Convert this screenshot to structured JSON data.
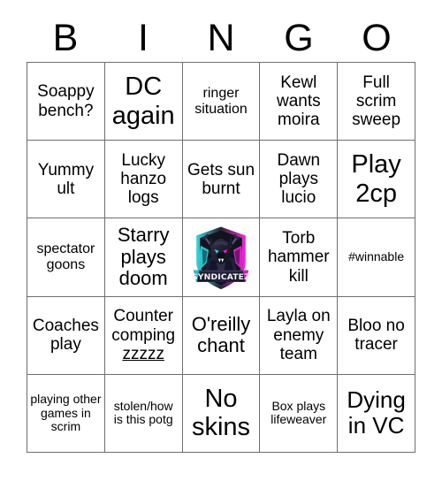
{
  "header": {
    "letters": [
      "B",
      "I",
      "N",
      "G",
      "O"
    ]
  },
  "grid": {
    "rows": [
      [
        {
          "text": "Soappy bench?",
          "size": "fs-m"
        },
        {
          "text": "DC again",
          "size": "fs-xxl"
        },
        {
          "text": "ringer situation",
          "size": "fs-s"
        },
        {
          "text": "Kewl wants moira",
          "size": "fs-m"
        },
        {
          "text": "Full scrim sweep",
          "size": "fs-m"
        }
      ],
      [
        {
          "text": "Yummy ult",
          "size": "fs-m"
        },
        {
          "text": "Lucky hanzo logs",
          "size": "fs-m"
        },
        {
          "text": "Gets sun burnt",
          "size": "fs-m"
        },
        {
          "text": "Dawn plays lucio",
          "size": "fs-m"
        },
        {
          "text": "Play 2cp",
          "size": "fs-xxl"
        }
      ],
      [
        {
          "text": "spectator goons",
          "size": "fs-s"
        },
        {
          "text": "Starry plays doom",
          "size": "fs-l"
        },
        {
          "text": "",
          "size": "fs-m",
          "logo": true
        },
        {
          "text": "Torb hammer kill",
          "size": "fs-m"
        },
        {
          "text": "#winnable",
          "size": "fs-xs"
        }
      ],
      [
        {
          "text": "Coaches play",
          "size": "fs-m"
        },
        {
          "text": "Counter comping zzzzz",
          "size": "fs-m",
          "underline_last_word": true
        },
        {
          "text": "O'reilly chant",
          "size": "fs-l"
        },
        {
          "text": "Layla on enemy team",
          "size": "fs-m"
        },
        {
          "text": "Bloo no tracer",
          "size": "fs-m"
        }
      ],
      [
        {
          "text": "playing other games in scrim",
          "size": "fs-xs"
        },
        {
          "text": "stolen/how is this potg",
          "size": "fs-xs"
        },
        {
          "text": "No skins",
          "size": "fs-xxl"
        },
        {
          "text": "Box plays lifeweaver",
          "size": "fs-xs"
        },
        {
          "text": "Dying in VC",
          "size": "fs-xl"
        }
      ]
    ]
  },
  "logo": {
    "name": "syndicatez-team-logo",
    "banner_text": "SYNDICATEZ",
    "colors": {
      "cyan": "#2ad6e0",
      "magenta": "#ef1fd8",
      "dark": "#1a1a28",
      "darker": "#0d0d16",
      "mid": "#3a3a52",
      "white": "#ffffff"
    }
  },
  "style": {
    "border_color": "#6e6e6e",
    "text_color": "#000000",
    "background": "#ffffff"
  }
}
